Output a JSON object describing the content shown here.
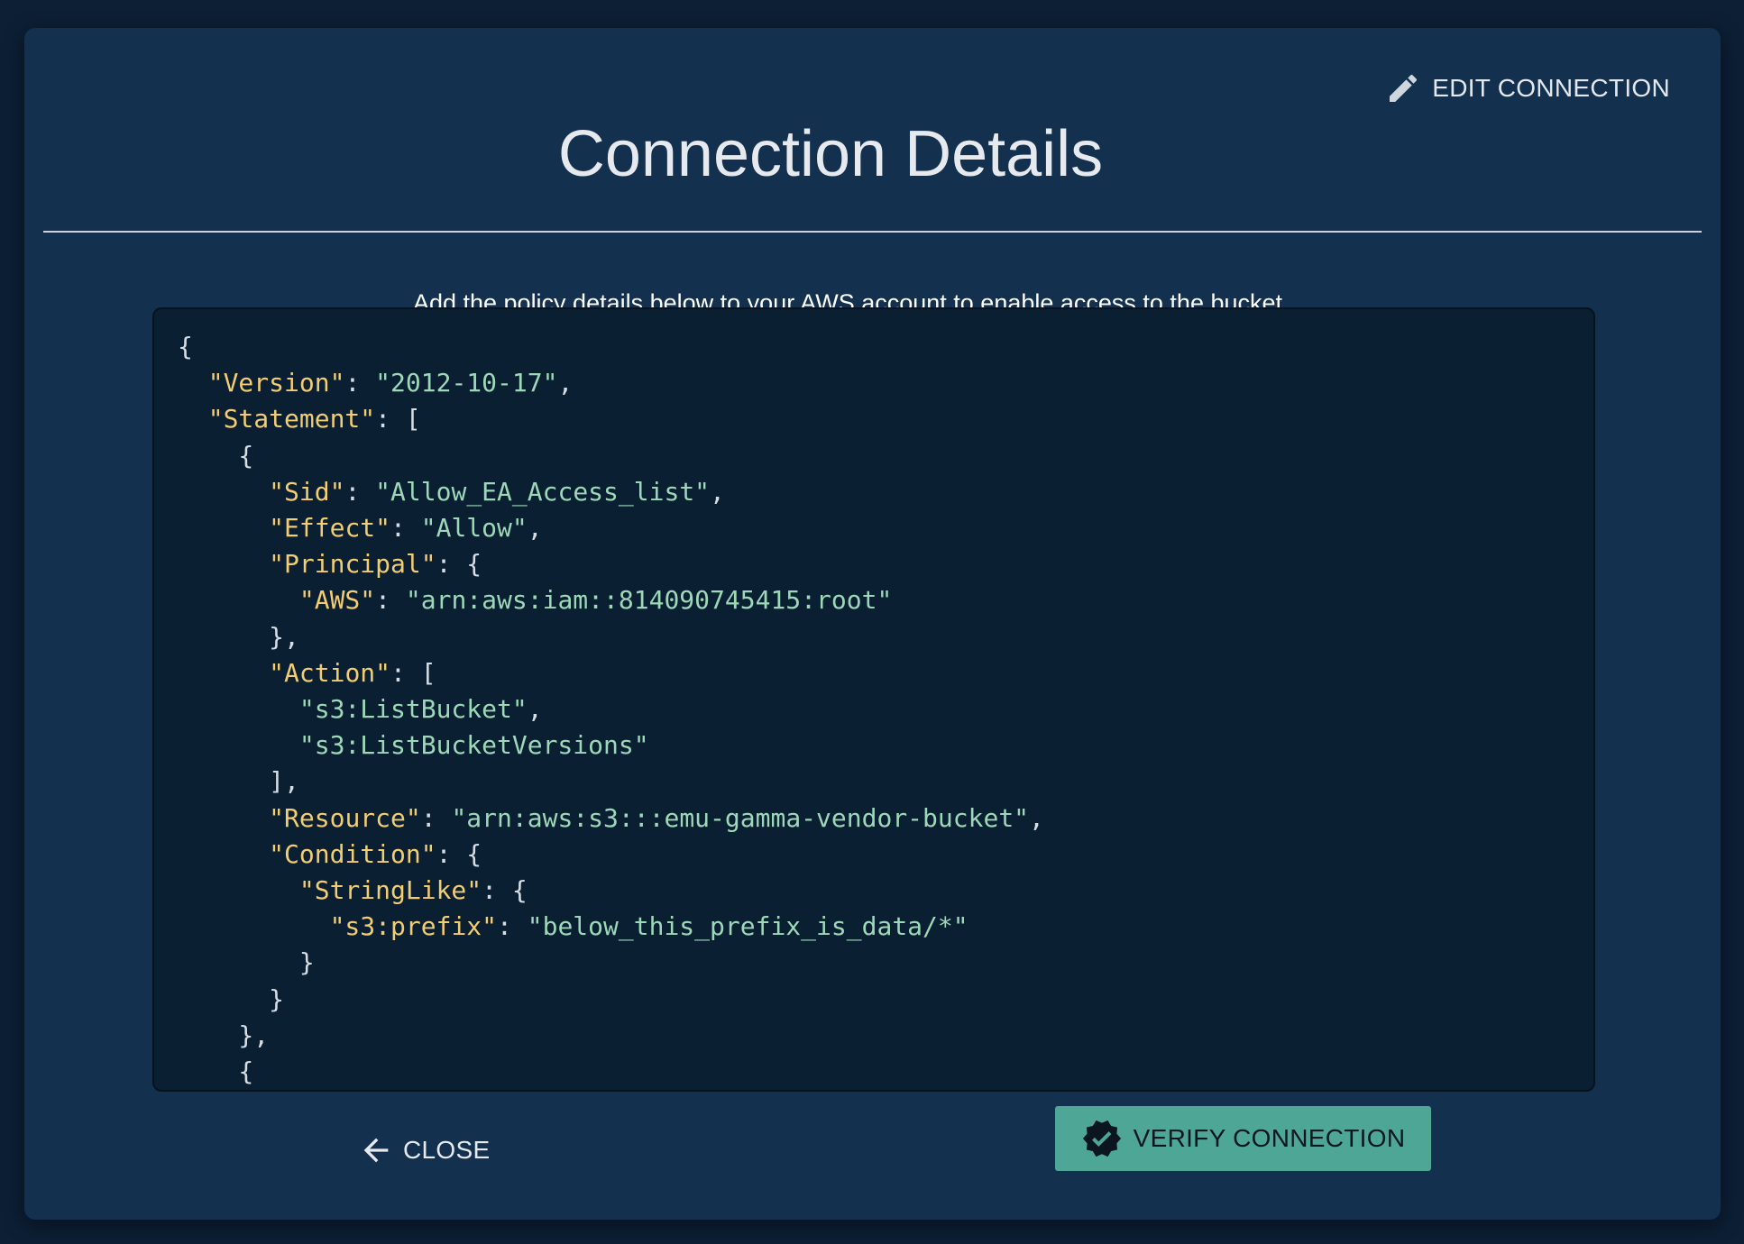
{
  "dialog": {
    "title": "Connection Details",
    "edit_label": "EDIT CONNECTION",
    "subtitle": "Add the policy details below to your AWS account to enable access to the bucket",
    "close_label": "CLOSE",
    "verify_label": "VERIFY CONNECTION",
    "icons": {
      "edit": "pencil-icon",
      "close": "arrow-left-icon",
      "verify": "verified-badge-icon"
    }
  },
  "policy": {
    "lines": [
      [
        {
          "t": "p",
          "v": "{"
        }
      ],
      [
        {
          "t": "p",
          "v": "  "
        },
        {
          "t": "k",
          "v": "\"Version\""
        },
        {
          "t": "p",
          "v": ": "
        },
        {
          "t": "s",
          "v": "\"2012-10-17\""
        },
        {
          "t": "p",
          "v": ","
        }
      ],
      [
        {
          "t": "p",
          "v": "  "
        },
        {
          "t": "k",
          "v": "\"Statement\""
        },
        {
          "t": "p",
          "v": ": ["
        }
      ],
      [
        {
          "t": "p",
          "v": "    {"
        }
      ],
      [
        {
          "t": "p",
          "v": "      "
        },
        {
          "t": "k",
          "v": "\"Sid\""
        },
        {
          "t": "p",
          "v": ": "
        },
        {
          "t": "s",
          "v": "\"Allow_EA_Access_list\""
        },
        {
          "t": "p",
          "v": ","
        }
      ],
      [
        {
          "t": "p",
          "v": "      "
        },
        {
          "t": "k",
          "v": "\"Effect\""
        },
        {
          "t": "p",
          "v": ": "
        },
        {
          "t": "s",
          "v": "\"Allow\""
        },
        {
          "t": "p",
          "v": ","
        }
      ],
      [
        {
          "t": "p",
          "v": "      "
        },
        {
          "t": "k",
          "v": "\"Principal\""
        },
        {
          "t": "p",
          "v": ": {"
        }
      ],
      [
        {
          "t": "p",
          "v": "        "
        },
        {
          "t": "k",
          "v": "\"AWS\""
        },
        {
          "t": "p",
          "v": ": "
        },
        {
          "t": "s",
          "v": "\"arn:aws:iam::814090745415:root\""
        }
      ],
      [
        {
          "t": "p",
          "v": "      },"
        }
      ],
      [
        {
          "t": "p",
          "v": "      "
        },
        {
          "t": "k",
          "v": "\"Action\""
        },
        {
          "t": "p",
          "v": ": ["
        }
      ],
      [
        {
          "t": "p",
          "v": "        "
        },
        {
          "t": "s",
          "v": "\"s3:ListBucket\""
        },
        {
          "t": "p",
          "v": ","
        }
      ],
      [
        {
          "t": "p",
          "v": "        "
        },
        {
          "t": "s",
          "v": "\"s3:ListBucketVersions\""
        }
      ],
      [
        {
          "t": "p",
          "v": "      ],"
        }
      ],
      [
        {
          "t": "p",
          "v": "      "
        },
        {
          "t": "k",
          "v": "\"Resource\""
        },
        {
          "t": "p",
          "v": ": "
        },
        {
          "t": "s",
          "v": "\"arn:aws:s3:::emu-gamma-vendor-bucket\""
        },
        {
          "t": "p",
          "v": ","
        }
      ],
      [
        {
          "t": "p",
          "v": "      "
        },
        {
          "t": "k",
          "v": "\"Condition\""
        },
        {
          "t": "p",
          "v": ": {"
        }
      ],
      [
        {
          "t": "p",
          "v": "        "
        },
        {
          "t": "k",
          "v": "\"StringLike\""
        },
        {
          "t": "p",
          "v": ": {"
        }
      ],
      [
        {
          "t": "p",
          "v": "          "
        },
        {
          "t": "k",
          "v": "\"s3:prefix\""
        },
        {
          "t": "p",
          "v": ": "
        },
        {
          "t": "s",
          "v": "\"below_this_prefix_is_data/*\""
        }
      ],
      [
        {
          "t": "p",
          "v": "        }"
        }
      ],
      [
        {
          "t": "p",
          "v": "      }"
        }
      ],
      [
        {
          "t": "p",
          "v": "    },"
        }
      ],
      [
        {
          "t": "p",
          "v": "    {"
        }
      ]
    ]
  },
  "colors": {
    "page_bg": "#0c1f35",
    "dialog_bg": "#13304f",
    "code_bg": "#0b1f33",
    "json_key": "#f2cd72",
    "json_string": "#9dd9b8",
    "verify_button": "#4ea796"
  }
}
